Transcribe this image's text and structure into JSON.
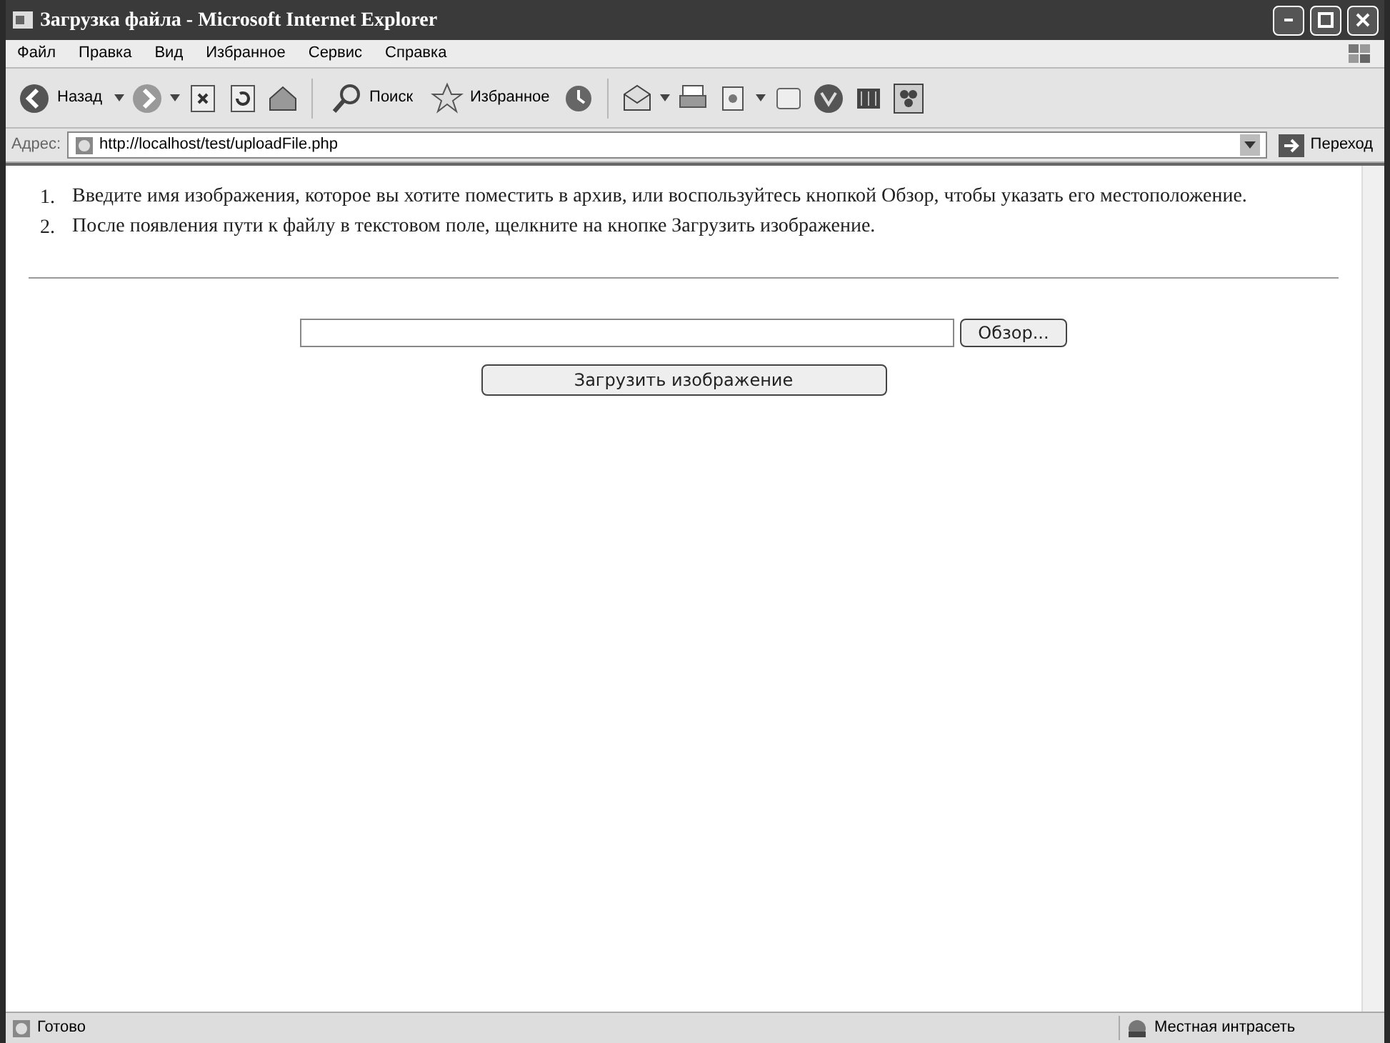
{
  "window": {
    "title": "Загрузка файла - Microsoft Internet Explorer"
  },
  "menu": [
    "Файл",
    "Правка",
    "Вид",
    "Избранное",
    "Сервис",
    "Справка"
  ],
  "toolbar": {
    "back": "Назад",
    "search": "Поиск",
    "favorites": "Избранное"
  },
  "address_bar": {
    "label": "Адрес:",
    "url": "http://localhost/test/uploadFile.php",
    "go": "Переход"
  },
  "instructions": [
    {
      "number": "1.",
      "text": "Введите имя изображения, которое вы хотите поместить в архив, или воспользуйтесь кнопкой Обзор, чтобы указать его местоположение."
    },
    {
      "number": "2.",
      "text": "После появления пути к файлу в текстовом поле, щелкните на кнопке Загрузить изображение."
    }
  ],
  "browse_button": "Обзор...",
  "upload_button": "Загрузить изображение",
  "status_bar": {
    "status": "Готово",
    "zone": "Местная интрасеть"
  }
}
